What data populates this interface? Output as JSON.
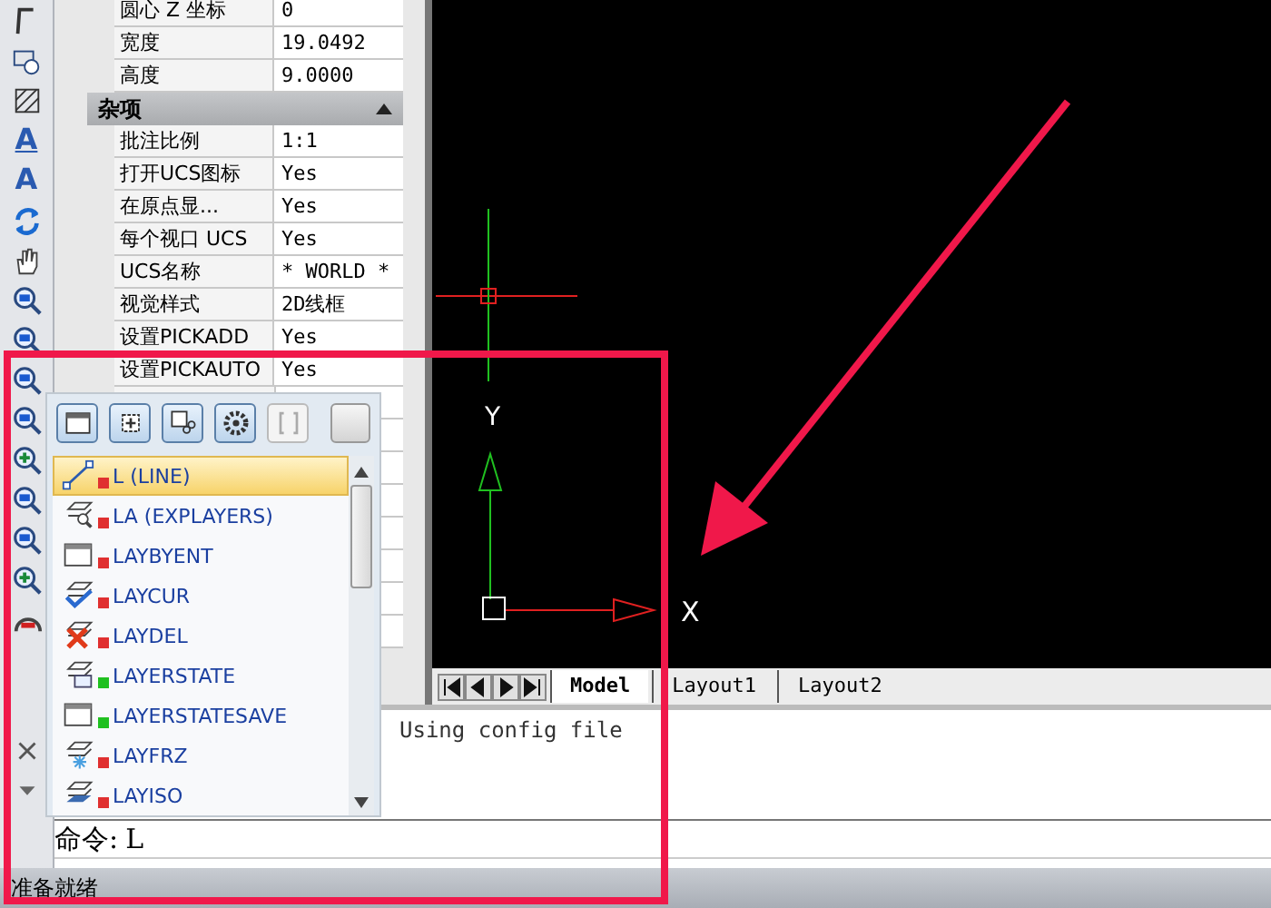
{
  "properties": {
    "rows_top": [
      {
        "label": "圆心 Z 坐标",
        "value": "0"
      },
      {
        "label": "宽度",
        "value": "19.0492"
      },
      {
        "label": "高度",
        "value": "9.0000"
      }
    ],
    "section": {
      "title": "杂项",
      "expanded": true
    },
    "rows": [
      {
        "label": "批注比例",
        "value": "1:1"
      },
      {
        "label": "打开UCS图标",
        "value": "Yes"
      },
      {
        "label": "在原点显...",
        "value": "Yes"
      },
      {
        "label": "每个视口 UCS",
        "value": "Yes"
      },
      {
        "label": "UCS名称",
        "value": "* WORLD *"
      },
      {
        "label": "视觉样式",
        "value": "2D线框"
      },
      {
        "label": "设置PICKADD",
        "value": "Yes"
      },
      {
        "label": "设置PICKAUTO",
        "value": "Yes"
      }
    ]
  },
  "left_toolbar": {
    "text_tools": [
      "A",
      "A"
    ]
  },
  "drawing": {
    "y_label": "Y",
    "x_label": "X"
  },
  "layout_tabs": [
    {
      "label": "Model",
      "selected": true
    },
    {
      "label": "Layout1",
      "selected": false
    },
    {
      "label": "Layout2",
      "selected": false
    }
  ],
  "command_history": [
    "Using config file"
  ],
  "command_line": {
    "prompt": "命令:",
    "value": "L"
  },
  "autocomplete": {
    "items": [
      {
        "label": "L (LINE)",
        "selected": true,
        "color": "#e03030"
      },
      {
        "label": "LA (EXPLAYERS)",
        "selected": false,
        "color": "#e03030"
      },
      {
        "label": "LAYBYENT",
        "selected": false,
        "color": "#e03030"
      },
      {
        "label": "LAYCUR",
        "selected": false,
        "color": "#e03030"
      },
      {
        "label": "LAYDEL",
        "selected": false,
        "color": "#e03030"
      },
      {
        "label": "LAYERSTATE",
        "selected": false,
        "color": "#20c020"
      },
      {
        "label": "LAYERSTATESAVE",
        "selected": false,
        "color": "#20c020"
      },
      {
        "label": "LAYFRZ",
        "selected": false,
        "color": "#e03030"
      },
      {
        "label": "LAYISO",
        "selected": false,
        "color": "#e03030"
      }
    ]
  },
  "status_bar": {
    "text": "准备就绪"
  }
}
